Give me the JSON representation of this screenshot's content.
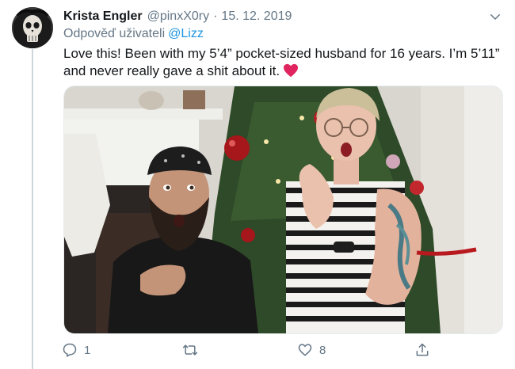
{
  "tweet": {
    "author": {
      "display_name": "Krista Engler",
      "handle": "@pinxX0ry",
      "avatar_icon": "skull-avatar"
    },
    "separator": "·",
    "date": "15. 12. 2019",
    "reply_prefix": "Odpověď uživateli",
    "reply_mention": "@Lizz",
    "text": "Love this! Been with my 5’4” pocket-sized husband for 16 years. I’m 5’11” and never really gave a shit about it.",
    "emoji": "red-heart-icon",
    "media": {
      "kind": "photo",
      "icon": "photo"
    },
    "actions": {
      "reply": {
        "icon": "reply-icon",
        "count": "1"
      },
      "retweet": {
        "icon": "retweet-icon",
        "count": ""
      },
      "like": {
        "icon": "like-icon",
        "count": "8"
      },
      "share": {
        "icon": "share-icon"
      }
    },
    "colors": {
      "name": "#14171a",
      "secondary": "#657786",
      "link": "#1b95e0",
      "heart": "#e0245e",
      "thread_line": "#ccd6dd"
    }
  }
}
